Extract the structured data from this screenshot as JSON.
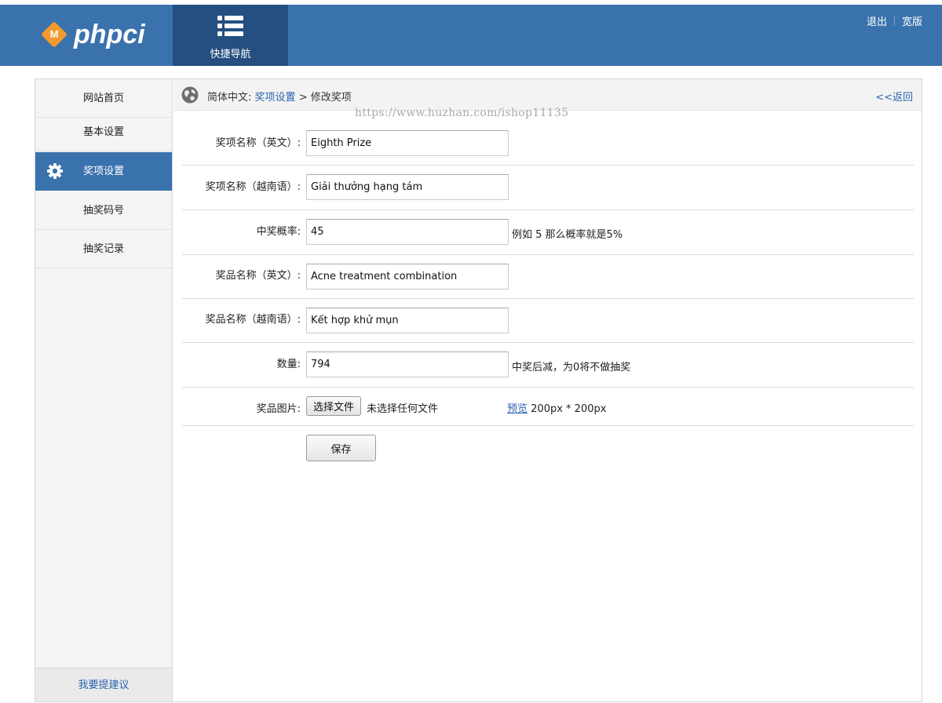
{
  "header": {
    "logo_text": "phpci",
    "logo_mark": "M",
    "quicknav_label": "快捷导航",
    "quicknav_icon": "list-icon",
    "logout": "退出",
    "wide": "宽版"
  },
  "sidebar": {
    "items": [
      {
        "label": "网站首页"
      },
      {
        "label": "基本设置"
      },
      {
        "label": "奖项设置",
        "active": true,
        "icon": "gear-icon"
      },
      {
        "label": "抽奖码号"
      },
      {
        "label": "抽奖记录"
      }
    ],
    "feedback": "我要提建议"
  },
  "breadcrumb": {
    "prefix": "简体中文:",
    "link": "奖项设置",
    "sep": ">",
    "current": "修改奖项",
    "back": "<<返回"
  },
  "watermark": "https://www.huzhan.com/ishop11135",
  "form": {
    "name_en": {
      "label": "奖项名称（英文）:",
      "value": "Eighth Prize"
    },
    "name_vi": {
      "label": "奖项名称（越南语）:",
      "value": "Giải thưởng hạng tám"
    },
    "probability": {
      "label": "中奖概率:",
      "value": "45",
      "hint": "例如 5 那么概率就是5%"
    },
    "prize_en": {
      "label": "奖品名称（英文）:",
      "value": "Acne treatment combination"
    },
    "prize_vi": {
      "label": "奖品名称（越南语）:",
      "value": "Kết hợp khử mụn"
    },
    "quantity": {
      "label": "数量:",
      "value": "794",
      "hint": "中奖后减，为0将不做抽奖"
    },
    "image": {
      "label": "奖品图片:",
      "button": "选择文件",
      "nofile": "未选择任何文件",
      "preview_link": "预览",
      "size_hint": "200px * 200px"
    },
    "save": "保存"
  },
  "colors": {
    "primary": "#3a72ad",
    "nav_dark": "#244f80",
    "logo_orange": "#f29a2e",
    "link": "#2a64b0"
  }
}
